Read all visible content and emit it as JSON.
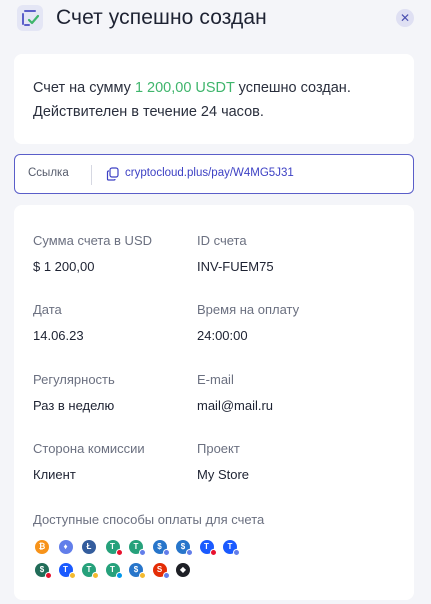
{
  "header": {
    "title": "Счет успешно создан",
    "close_icon": "close-icon",
    "invoice_icon": "invoice-check-icon"
  },
  "message": {
    "prefix": "Счет на сумму ",
    "amount": "1 200,00 USDT",
    "suffix": " успешно создан. Действителен в течение 24 часов."
  },
  "link": {
    "label": "Ссылка",
    "icon": "copy-icon",
    "url": "cryptocloud.plus/pay/W4MG5J31"
  },
  "details": {
    "amount_usd_label": "Сумма счета в USD",
    "amount_usd_value": "$ 1 200,00",
    "invoice_id_label": "ID счета",
    "invoice_id_value": "INV-FUEM75",
    "date_label": "Дата",
    "date_value": "14.06.23",
    "payment_time_label": "Время на оплату",
    "payment_time_value": "24:00:00",
    "regularity_label": "Регулярность",
    "regularity_value": "Раз в неделю",
    "email_label": "E-mail",
    "email_value": "mail@mail.ru",
    "commission_label": "Сторона комиссии",
    "commission_value": "Клиент",
    "project_label": "Проект",
    "project_value": "My Store"
  },
  "payment_methods": {
    "label": "Доступные способы оплаты для счета",
    "row1": [
      {
        "name": "bitcoin-icon",
        "color": "#f7931a",
        "glyph": "₿"
      },
      {
        "name": "ethereum-icon",
        "color": "#627eea",
        "glyph": "♦"
      },
      {
        "name": "litecoin-icon",
        "color": "#345d9d",
        "glyph": "Ł"
      },
      {
        "name": "usdt-tron-icon",
        "color": "#26a17b",
        "glyph": "T",
        "net": "#e8112d"
      },
      {
        "name": "usdt-eth-icon",
        "color": "#26a17b",
        "glyph": "T",
        "net": "#627eea"
      },
      {
        "name": "usdc-eth-icon",
        "color": "#2775ca",
        "glyph": "$",
        "net": "#627eea"
      },
      {
        "name": "usdc-bsc-icon",
        "color": "#2775ca",
        "glyph": "$",
        "net": "#627eea"
      },
      {
        "name": "tusd-tron-icon",
        "color": "#1a5aff",
        "glyph": "T",
        "net": "#e8112d"
      },
      {
        "name": "tusd-eth-icon",
        "color": "#1a5aff",
        "glyph": "T",
        "net": "#627eea"
      }
    ],
    "row2": [
      {
        "name": "usdd-tron-icon",
        "color": "#216c58",
        "glyph": "$",
        "net": "#e8112d"
      },
      {
        "name": "tusd-bsc-icon",
        "color": "#1a5aff",
        "glyph": "T",
        "net": "#f3ba2f"
      },
      {
        "name": "usdt-bsc-icon",
        "color": "#26a17b",
        "glyph": "T",
        "net": "#f3ba2f"
      },
      {
        "name": "usdt-ton-icon",
        "color": "#26a17b",
        "glyph": "T",
        "net": "#0098ea"
      },
      {
        "name": "usdc-bsc-2-icon",
        "color": "#2775ca",
        "glyph": "$",
        "net": "#f3ba2f"
      },
      {
        "name": "shib-icon",
        "color": "#e42d06",
        "glyph": "S",
        "net": "#627eea"
      },
      {
        "name": "bnb-icon",
        "color": "#1e2026",
        "glyph": "◆"
      }
    ]
  }
}
